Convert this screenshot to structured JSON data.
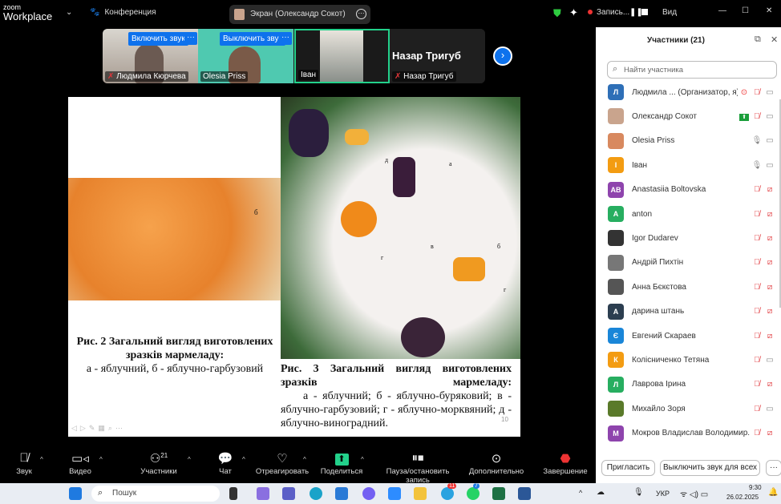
{
  "app": {
    "logo_top": "zoom",
    "logo_bottom": "Workplace",
    "meeting": "Конференция",
    "screen_share": "Экран (Олександр Сокот)",
    "recording": "Запись...",
    "view": "Вид"
  },
  "strip": {
    "tiles": [
      {
        "name": "Людмила Кюрчева",
        "button": "Включить звук"
      },
      {
        "name": "Olesia Priss",
        "button": "Выключить звук"
      },
      {
        "name": "Іван"
      },
      {
        "name": "Назар Тригуб",
        "big_name": "Назар Тригуб"
      }
    ]
  },
  "slide": {
    "fig2_title": "Рис. 2 Загальний вигляд виготовлених зразків мармеладу:",
    "fig2_text": "а - яблучний, б - яблучно-гарбузовий",
    "fig3_title": "Рис. 3 Загальний вигляд виготовлених зразків мармеладу:",
    "fig3_text": "а - яблучний; б - яблучно-буряковий; в - яблучно-гарбузовий; г - яблучно-морквяний; д - яблучно-виноградний.",
    "page_number": "10",
    "labels": {
      "a": "а",
      "b": "б",
      "v": "в",
      "g": "г",
      "d": "д"
    }
  },
  "panel": {
    "title": "Участники (21)",
    "search_placeholder": "Найти участника",
    "invite": "Пригласить",
    "mute_all": "Выключить звук для всех",
    "more": "···",
    "participants": [
      {
        "initial": "Л",
        "color": "#2e6fb7",
        "name": "Людмила ... (Организатор, я)",
        "mic": "muted",
        "video": "on",
        "extra": "record"
      },
      {
        "initial": "",
        "color": "#c9a48d",
        "name": "Олександр Сокот",
        "mic": "muted",
        "video": "on",
        "extra": "share"
      },
      {
        "initial": "",
        "color": "#d8895f",
        "name": "Olesia Priss",
        "mic": "on",
        "video": "on"
      },
      {
        "initial": "І",
        "color": "#f39c12",
        "name": "Іван",
        "mic": "on",
        "video": "on"
      },
      {
        "initial": "AB",
        "color": "#8e44ad",
        "name": "Anastasiia Boltovska",
        "mic": "muted",
        "video": "off"
      },
      {
        "initial": "A",
        "color": "#27ae60",
        "name": "anton",
        "mic": "muted",
        "video": "off"
      },
      {
        "initial": "",
        "color": "#333",
        "name": "Igor Dudarev",
        "mic": "muted",
        "video": "off"
      },
      {
        "initial": "",
        "color": "#777",
        "name": "Андрій Пихтін",
        "mic": "muted",
        "video": "off"
      },
      {
        "initial": "",
        "color": "#555",
        "name": "Анна Бєкєтова",
        "mic": "muted",
        "video": "off"
      },
      {
        "initial": "А",
        "color": "#2c3e50",
        "name": "дарина штань",
        "mic": "muted",
        "video": "off"
      },
      {
        "initial": "Є",
        "color": "#1a86d8",
        "name": "Евгений Скараев",
        "mic": "muted",
        "video": "off"
      },
      {
        "initial": "К",
        "color": "#f39c12",
        "name": "Колісниченко Тетяна",
        "mic": "muted",
        "video": "on"
      },
      {
        "initial": "Л",
        "color": "#27ae60",
        "name": "Лаврова Ірина",
        "mic": "muted",
        "video": "off"
      },
      {
        "initial": "",
        "color": "#5a7a2a",
        "name": "Михайло Зоря",
        "mic": "muted",
        "video": "on"
      },
      {
        "initial": "М",
        "color": "#8e44ad",
        "name": "Мокров Владислав Володимир...",
        "mic": "muted",
        "video": "off"
      }
    ]
  },
  "toolbar": {
    "audio": "Звук",
    "video": "Видео",
    "participants": "Участники",
    "participants_count": "21",
    "chat": "Чат",
    "react": "Отреагировать",
    "share": "Поделиться",
    "record": "Пауза/остановить запись",
    "more": "Дополнительно",
    "end": "Завершение"
  },
  "taskbar": {
    "search": "Пошук",
    "lang": "УКР",
    "time": "9:30",
    "date": "26.02.2025",
    "telegram_badge": "11",
    "whatsapp_badge": "7"
  }
}
